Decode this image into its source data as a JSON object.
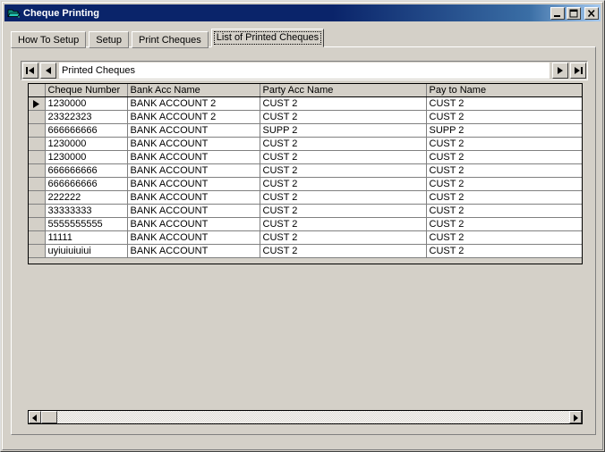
{
  "window": {
    "title": "Cheque Printing",
    "icon": "app-folder-icon",
    "colors": {
      "titlebar_start": "#0a246a",
      "titlebar_end": "#a6caf0",
      "face": "#d4d0c8",
      "grid_background": "#ffffff"
    },
    "buttons": {
      "minimize": "Minimize",
      "maximize": "Maximize",
      "close": "Close"
    }
  },
  "tabs": [
    {
      "label": "How To Setup",
      "active": false
    },
    {
      "label": "Setup",
      "active": false
    },
    {
      "label": "Print Cheques",
      "active": false
    },
    {
      "label": "List of Printed Cheques",
      "active": true
    }
  ],
  "navigator": {
    "label": "Printed Cheques",
    "first_button": "first-record",
    "prev_button": "previous-record",
    "next_button": "next-record",
    "last_button": "last-record"
  },
  "grid": {
    "columns": [
      "Cheque Number",
      "Bank Acc Name",
      "Party Acc Name",
      "Pay to Name"
    ],
    "selected_row_index": 0,
    "rows": [
      {
        "cheque_number": "1230000",
        "bank_acc_name": "BANK ACCOUNT 2",
        "party_acc_name": "CUST 2",
        "pay_to_name": "CUST 2"
      },
      {
        "cheque_number": "23322323",
        "bank_acc_name": "BANK ACCOUNT 2",
        "party_acc_name": "CUST 2",
        "pay_to_name": "CUST 2"
      },
      {
        "cheque_number": "666666666",
        "bank_acc_name": "BANK ACCOUNT",
        "party_acc_name": "SUPP 2",
        "pay_to_name": "SUPP 2"
      },
      {
        "cheque_number": "1230000",
        "bank_acc_name": "BANK ACCOUNT",
        "party_acc_name": "CUST 2",
        "pay_to_name": "CUST 2"
      },
      {
        "cheque_number": "1230000",
        "bank_acc_name": "BANK ACCOUNT",
        "party_acc_name": "CUST 2",
        "pay_to_name": "CUST 2"
      },
      {
        "cheque_number": "666666666",
        "bank_acc_name": "BANK ACCOUNT",
        "party_acc_name": "CUST 2",
        "pay_to_name": "CUST 2"
      },
      {
        "cheque_number": "666666666",
        "bank_acc_name": "BANK ACCOUNT",
        "party_acc_name": "CUST 2",
        "pay_to_name": "CUST 2"
      },
      {
        "cheque_number": "222222",
        "bank_acc_name": "BANK ACCOUNT",
        "party_acc_name": "CUST 2",
        "pay_to_name": "CUST 2"
      },
      {
        "cheque_number": "33333333",
        "bank_acc_name": "BANK ACCOUNT",
        "party_acc_name": "CUST 2",
        "pay_to_name": "CUST 2"
      },
      {
        "cheque_number": "5555555555",
        "bank_acc_name": "BANK ACCOUNT",
        "party_acc_name": "CUST 2",
        "pay_to_name": "CUST 2"
      },
      {
        "cheque_number": "11111",
        "bank_acc_name": "BANK ACCOUNT",
        "party_acc_name": "CUST 2",
        "pay_to_name": "CUST 2"
      },
      {
        "cheque_number": "uyiuiuiuiui",
        "bank_acc_name": "BANK ACCOUNT",
        "party_acc_name": "CUST 2",
        "pay_to_name": "CUST 2"
      }
    ]
  },
  "scrollbar": {
    "left_button": "scroll-left",
    "right_button": "scroll-right",
    "orientation": "horizontal"
  }
}
